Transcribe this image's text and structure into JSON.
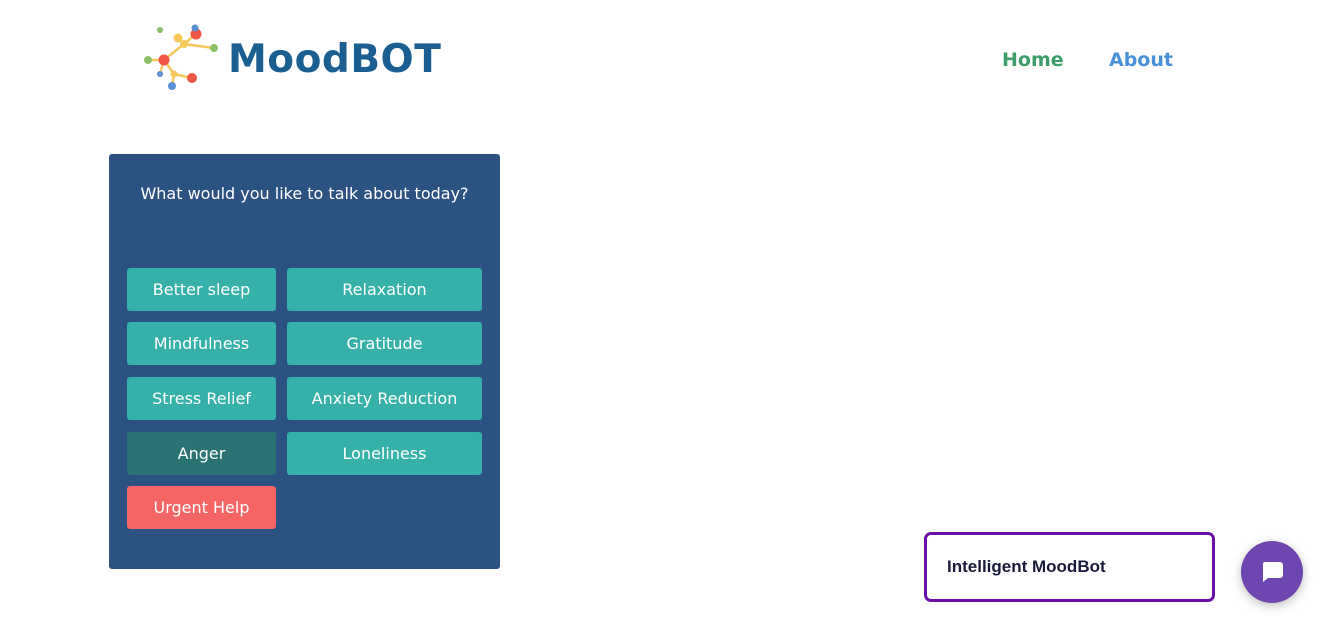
{
  "header": {
    "logo_text": "MoodBOT",
    "nav": {
      "home": "Home",
      "about": "About"
    }
  },
  "panel": {
    "question": "What would you like to talk about today?",
    "topics": [
      "Better sleep",
      "Relaxation",
      "Mindfulness",
      "Gratitude",
      "Stress Relief",
      "Anxiety Reduction",
      "Anger",
      "Loneliness",
      "Urgent Help"
    ]
  },
  "chat": {
    "label": "Intelligent MoodBot",
    "icon": "chat-bubble-icon"
  },
  "colors": {
    "brand": "#1b5e92",
    "panel_bg": "#2c5282",
    "topic_button": "#36b1aa",
    "topic_button_active": "#2b7373",
    "urgent_button": "#f56565",
    "chat_fab": "#6e46b0",
    "chat_label_border": "#6b0fa7",
    "nav_home": "#3e9c69",
    "nav_about": "#4a90d9"
  }
}
